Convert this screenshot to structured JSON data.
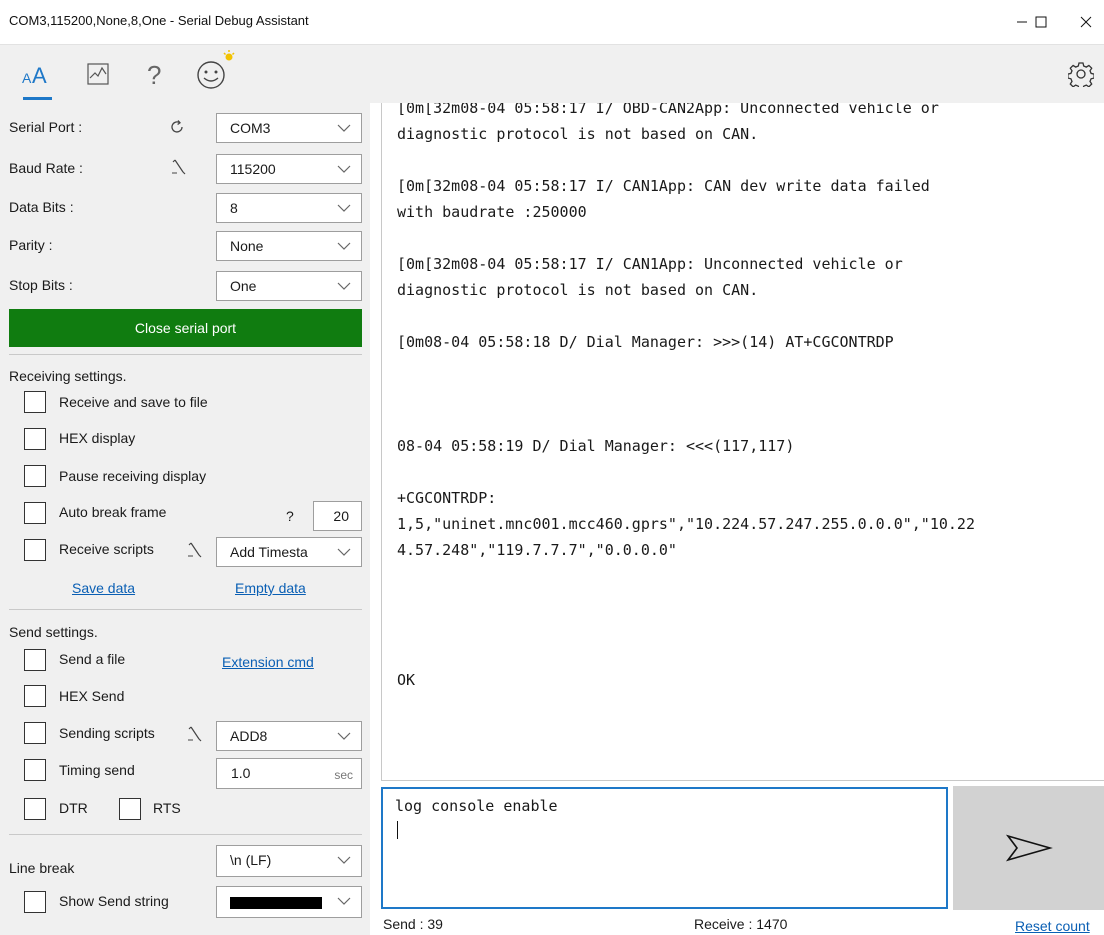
{
  "window": {
    "title": "COM3,115200,None,8,One - Serial Debug Assistant"
  },
  "toolbar": {
    "icons": [
      "font-icon",
      "chart-icon",
      "help-icon",
      "smiley-icon",
      "settings-icon"
    ],
    "accent": "#1e78c8"
  },
  "port": {
    "serial_port_label": "Serial Port :",
    "serial_port_value": "COM3",
    "baud_rate_label": "Baud Rate :",
    "baud_rate_value": "115200",
    "data_bits_label": "Data Bits :",
    "data_bits_value": "8",
    "parity_label": "Parity :",
    "parity_value": "None",
    "stop_bits_label": "Stop Bits :",
    "stop_bits_value": "One",
    "close_button_label": "Close serial port",
    "close_button_color": "#107c10"
  },
  "receive": {
    "section_title": "Receiving settings.",
    "save_to_file_label": "Receive and save to file",
    "hex_display_label": "HEX display",
    "pause_label": "Pause receiving display",
    "auto_break_label": "Auto break frame",
    "auto_break_help": "?",
    "auto_break_value": "20",
    "scripts_label": "Receive scripts",
    "scripts_value": "Add Timesta",
    "save_data_link": "Save data",
    "empty_data_link": "Empty data"
  },
  "send": {
    "section_title": "Send settings.",
    "send_file_label": "Send a file",
    "extension_cmd_link": "Extension cmd",
    "hex_send_label": "HEX Send",
    "scripts_label": "Sending scripts",
    "scripts_value": "ADD8",
    "timing_label": "Timing send",
    "timing_value": "1.0",
    "timing_unit": "sec",
    "dtr_label": "DTR",
    "rts_label": "RTS",
    "line_break_label": "Line break",
    "line_break_value": "\\n (LF)",
    "show_send_label": "Show Send string",
    "show_send_color": "#000000"
  },
  "console": {
    "lines": [
      "[0m[32m08-04 05:58:17 I/ OBD-CAN2App: Unconnected vehicle or",
      "diagnostic protocol is not based on CAN.",
      "",
      "[0m[32m08-04 05:58:17 I/ CAN1App: CAN dev write data failed",
      "with baudrate :250000",
      "",
      "[0m[32m08-04 05:58:17 I/ CAN1App: Unconnected vehicle or",
      "diagnostic protocol is not based on CAN.",
      "",
      "[0m08-04 05:58:18 D/ Dial Manager: >>>(14) AT+CGCONTRDP",
      "",
      "",
      "",
      "08-04 05:58:19 D/ Dial Manager: <<<(117,117)",
      "",
      "+CGCONTRDP:",
      "1,5,\"uninet.mnc001.mcc460.gprs\",\"10.224.57.247.255.0.0.0\",\"10.22",
      "4.57.248\",\"119.7.7.7\",\"0.0.0.0\"",
      "",
      "",
      "",
      "",
      "OK"
    ]
  },
  "input": {
    "text": "log console enable"
  },
  "status": {
    "send": "Send : 39",
    "receive": "Receive : 1470",
    "reset": "Reset count"
  }
}
